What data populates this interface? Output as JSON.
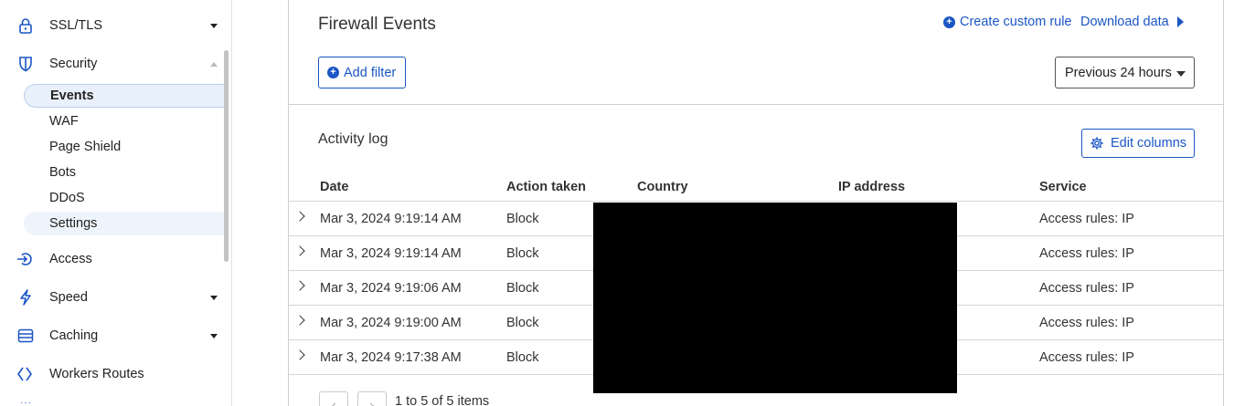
{
  "sidebar": {
    "items": [
      {
        "label": "SSL/TLS",
        "icon": "lock-icon"
      },
      {
        "label": "Security",
        "icon": "shield-icon"
      },
      {
        "label": "Access",
        "icon": "access-icon"
      },
      {
        "label": "Speed",
        "icon": "lightning-icon"
      },
      {
        "label": "Caching",
        "icon": "database-icon"
      },
      {
        "label": "Workers Routes",
        "icon": "workers-icon"
      }
    ],
    "security_sub": [
      "Events",
      "WAF",
      "Page Shield",
      "Bots",
      "DDoS",
      "Settings"
    ],
    "active_sub": "Events"
  },
  "main": {
    "title": "Firewall Events",
    "create_rule": "Create custom rule",
    "download": "Download data",
    "add_filter": "Add filter",
    "time_range": "Previous 24 hours",
    "activity_title": "Activity log",
    "edit_columns": "Edit columns",
    "columns": [
      "Date",
      "Action taken",
      "Country",
      "IP address",
      "Service"
    ],
    "rows": [
      {
        "date": "Mar 3, 2024 9:19:14 AM",
        "action": "Block",
        "service": "Access rules: IP"
      },
      {
        "date": "Mar 3, 2024 9:19:14 AM",
        "action": "Block",
        "service": "Access rules: IP"
      },
      {
        "date": "Mar 3, 2024 9:19:06 AM",
        "action": "Block",
        "service": "Access rules: IP"
      },
      {
        "date": "Mar 3, 2024 9:19:00 AM",
        "action": "Block",
        "service": "Access rules: IP"
      },
      {
        "date": "Mar 3, 2024 9:17:38 AM",
        "action": "Block",
        "service": "Access rules: IP"
      }
    ],
    "pagination": "1 to 5 of 5 items"
  },
  "colors": {
    "accent": "#1a56c4",
    "active_bg": "#e8f0fb",
    "redaction": "#000000"
  }
}
